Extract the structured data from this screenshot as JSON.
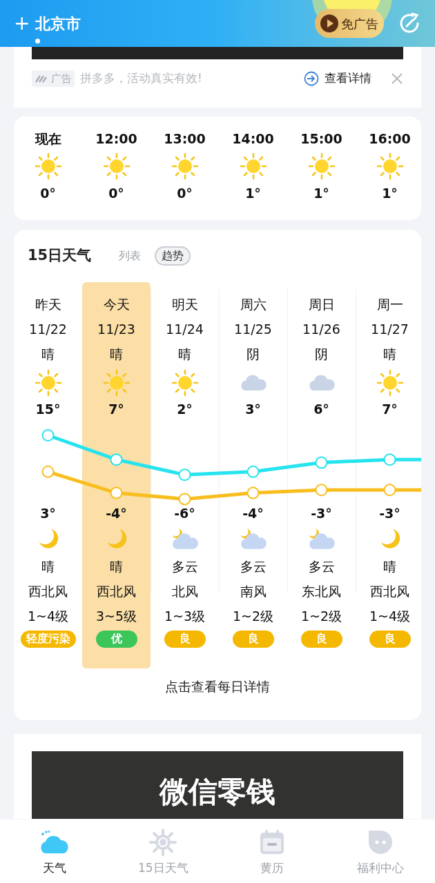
{
  "header": {
    "city": "北京市",
    "add": "+",
    "no_ads": "免广告"
  },
  "ad_strip": {
    "tag": "广告",
    "text": "拼多多，活动真实有效!",
    "details": "查看详情"
  },
  "hourly": [
    {
      "time": "现在",
      "kind": "sun",
      "temp": "0°"
    },
    {
      "time": "12:00",
      "kind": "sun",
      "temp": "0°"
    },
    {
      "time": "13:00",
      "kind": "sun",
      "temp": "0°"
    },
    {
      "time": "14:00",
      "kind": "sun",
      "temp": "1°"
    },
    {
      "time": "15:00",
      "kind": "sun",
      "temp": "1°"
    },
    {
      "time": "16:00",
      "kind": "sun",
      "temp": "1°"
    }
  ],
  "forecast": {
    "title": "15日天气",
    "views": [
      {
        "label": "列表",
        "selected": false
      },
      {
        "label": "趋势",
        "selected": true
      }
    ],
    "days": [
      {
        "day": "昨天",
        "date": "11/22",
        "day_weather": "晴",
        "day_icon": {
          "kind": "sun"
        },
        "high": "15°",
        "low": "3°",
        "night_icon": {
          "kind": "moon"
        },
        "night_weather": "晴",
        "wind": "西北风",
        "wind_level": "1~4级",
        "aqi": "轻度污染",
        "color": "#f5b800",
        "selected": false
      },
      {
        "day": "今天",
        "date": "11/23",
        "day_weather": "晴",
        "day_icon": {
          "kind": "sun"
        },
        "high": "7°",
        "low": "-4°",
        "night_icon": {
          "kind": "moon"
        },
        "night_weather": "晴",
        "wind": "西北风",
        "wind_level": "3~5级",
        "aqi": "优",
        "color": "#3cc65a",
        "selected": true
      },
      {
        "day": "明天",
        "date": "11/24",
        "day_weather": "晴",
        "day_icon": {
          "kind": "sun"
        },
        "high": "2°",
        "low": "-6°",
        "night_icon": {
          "kind": "cloud-moon"
        },
        "night_weather": "多云",
        "wind": "北风",
        "wind_level": "1~3级",
        "aqi": "良",
        "color": "#f5b800",
        "selected": false
      },
      {
        "day": "周六",
        "date": "11/25",
        "day_weather": "阴",
        "day_icon": {
          "kind": "cloud"
        },
        "high": "3°",
        "low": "-4°",
        "night_icon": {
          "kind": "cloud-moon"
        },
        "night_weather": "多云",
        "wind": "南风",
        "wind_level": "1~2级",
        "aqi": "良",
        "color": "#f5b800",
        "selected": false
      },
      {
        "day": "周日",
        "date": "11/26",
        "day_weather": "阴",
        "day_icon": {
          "kind": "cloud"
        },
        "high": "6°",
        "low": "-3°",
        "night_icon": {
          "kind": "cloud-moon"
        },
        "night_weather": "多云",
        "wind": "东北风",
        "wind_level": "1~2级",
        "aqi": "良",
        "color": "#f5b800",
        "selected": false
      },
      {
        "day": "周一",
        "date": "11/27",
        "day_weather": "晴",
        "day_icon": {
          "kind": "sun"
        },
        "high": "7°",
        "low": "-3°",
        "night_icon": {
          "kind": "moon"
        },
        "night_weather": "晴",
        "wind": "西北风",
        "wind_level": "1~4级",
        "aqi": "良",
        "color": "#f5b800",
        "selected": false
      }
    ],
    "details_link": "点击查看每日详情"
  },
  "ad_banner": {
    "text": "微信零钱"
  },
  "nav": [
    {
      "label": "天气",
      "kind": "weather",
      "selected": true
    },
    {
      "label": "15日天气",
      "kind": "fifteen",
      "selected": false
    },
    {
      "label": "黄历",
      "kind": "calendar",
      "selected": false
    },
    {
      "label": "福利中心",
      "kind": "bonus",
      "selected": false
    }
  ]
}
